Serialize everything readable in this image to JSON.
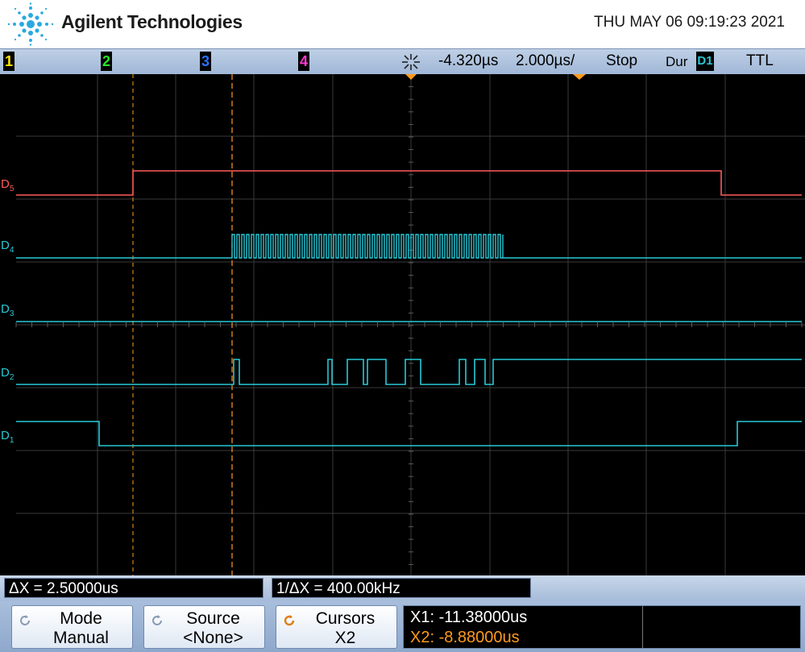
{
  "header": {
    "brand": "Agilent Technologies",
    "datetime": "THU MAY 06 09:19:23 2021"
  },
  "status": {
    "ch1": "1",
    "ch2": "2",
    "ch3": "3",
    "ch4": "4",
    "time_offset": "-4.320µs",
    "time_scale": "2.000µs/",
    "run_state": "Stop",
    "mode": "Dur",
    "trigger_source": "D1",
    "trigger_level": "TTL"
  },
  "channels": {
    "d5": "D5",
    "d4": "D4",
    "d3": "D3",
    "d2": "D2",
    "d1": "D1"
  },
  "measure": {
    "delta_x": "ΔX = 2.50000us",
    "inv_delta_x": "1/ΔX = 400.00kHz"
  },
  "softkeys": {
    "mode_label": "Mode",
    "mode_value": "Manual",
    "source_label": "Source",
    "source_value": "<None>",
    "cursors_label": "Cursors",
    "cursors_value": "X2"
  },
  "readout": {
    "x1": "X1: -11.38000us",
    "x2": "X2: -8.88000us"
  },
  "colors": {
    "ch1": "#ffe600",
    "ch2": "#27e627",
    "ch3": "#2b72ff",
    "ch4": "#ff3bd2",
    "d5_trace": "#ff5a5a",
    "digital_trace": "#29c8d6",
    "cursor": "#ff9a1e",
    "grid": "#3a3a3a"
  },
  "icons": {
    "logo": "agilent-spark-icon",
    "trigger": "trigger-spark-icon",
    "softkey": "rotate-arrow-icon"
  }
}
